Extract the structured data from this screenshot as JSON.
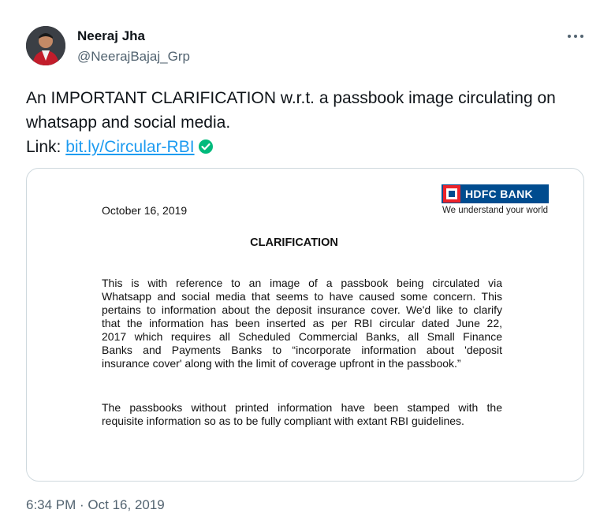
{
  "author": {
    "display_name": "Neeraj Jha",
    "handle": "@NeerajBajaj_Grp"
  },
  "tweet": {
    "text_line1": "An IMPORTANT CLARIFICATION w.r.t. a passbook image circulating on",
    "text_line2": "whatsapp and social media.",
    "link_prefix": "Link: ",
    "link_text": "bit.ly/Circular-RBI"
  },
  "document": {
    "date": "October 16, 2019",
    "logo_text": "HDFC BANK",
    "tagline": "We understand your world",
    "heading": "CLARIFICATION",
    "paragraph1_lines": [
      "This is with reference to an image of a passbook being circulated via",
      "Whatsapp and social media that seems to have caused some concern. This",
      "pertains to information about the deposit insurance cover. We'd like to clarify",
      "that the information has been inserted as per RBI circular dated June 22,",
      "2017 which requires all Scheduled Commercial Banks, all Small Finance",
      "Banks and Payments Banks to “incorporate information about 'deposit",
      "insurance cover'  along with the limit of coverage upfront in the passbook.”"
    ],
    "paragraph2_lines": [
      "The passbooks without printed information have been stamped with the",
      "requisite information so as to be fully compliant with extant RBI guidelines."
    ]
  },
  "timestamp": "6:34 PM · Oct 16, 2019",
  "colors": {
    "link": "#1d9bf0",
    "verified": "#00ba7c",
    "hdfc_blue": "#004c8f",
    "hdfc_red": "#ed232a"
  },
  "icons": [
    "avatar",
    "more-icon",
    "verified-check-icon",
    "hdfc-logo-icon"
  ]
}
